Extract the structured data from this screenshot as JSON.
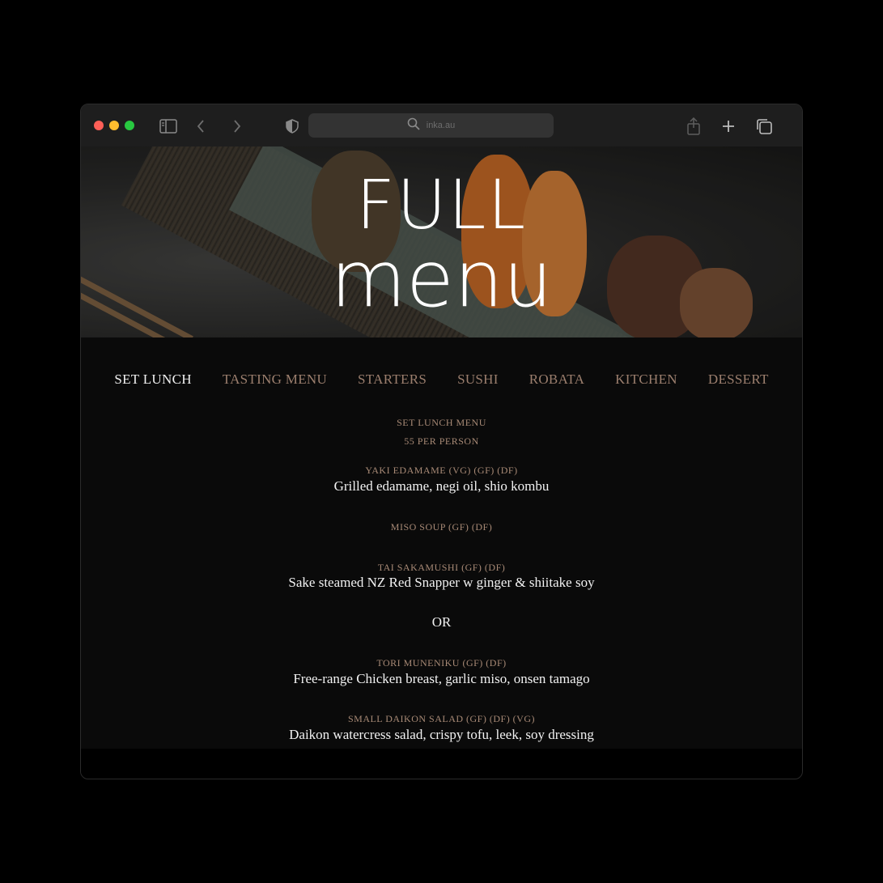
{
  "browser": {
    "url": "inka.au"
  },
  "hero": {
    "line1": "FULL",
    "line2": "menu"
  },
  "nav": {
    "items": [
      {
        "label": "SET LUNCH"
      },
      {
        "label": "TASTING MENU"
      },
      {
        "label": "STARTERS"
      },
      {
        "label": "SUSHI"
      },
      {
        "label": "ROBATA"
      },
      {
        "label": "KITCHEN"
      },
      {
        "label": "DESSERT"
      }
    ]
  },
  "set_lunch": {
    "title": "SET LUNCH MENU",
    "price": "55 PER PERSON",
    "items": [
      {
        "name": "YAKI EDAMAME (VG) (GF) (DF)",
        "desc": "Grilled edamame, negi oil, shio kombu"
      },
      {
        "name": "MISO SOUP (GF) (DF)",
        "desc": ""
      },
      {
        "name": "TAI SAKAMUSHI (GF) (DF)",
        "desc": "Sake steamed NZ Red Snapper w ginger & shiitake soy"
      },
      {
        "name": "TORI MUNENIKU (GF) (DF)",
        "desc": "Free-range Chicken breast, garlic miso, onsen tamago"
      },
      {
        "name": "SMALL DAIKON SALAD (GF) (DF) (VG)",
        "desc": "Daikon watercress salad, crispy tofu, leek, soy dressing"
      }
    ],
    "or_label": "OR"
  },
  "colors": {
    "accent": "#a88a76",
    "nav_inactive": "#9c7f6e",
    "text": "#f2f2f2",
    "background": "#0a0a0a"
  }
}
